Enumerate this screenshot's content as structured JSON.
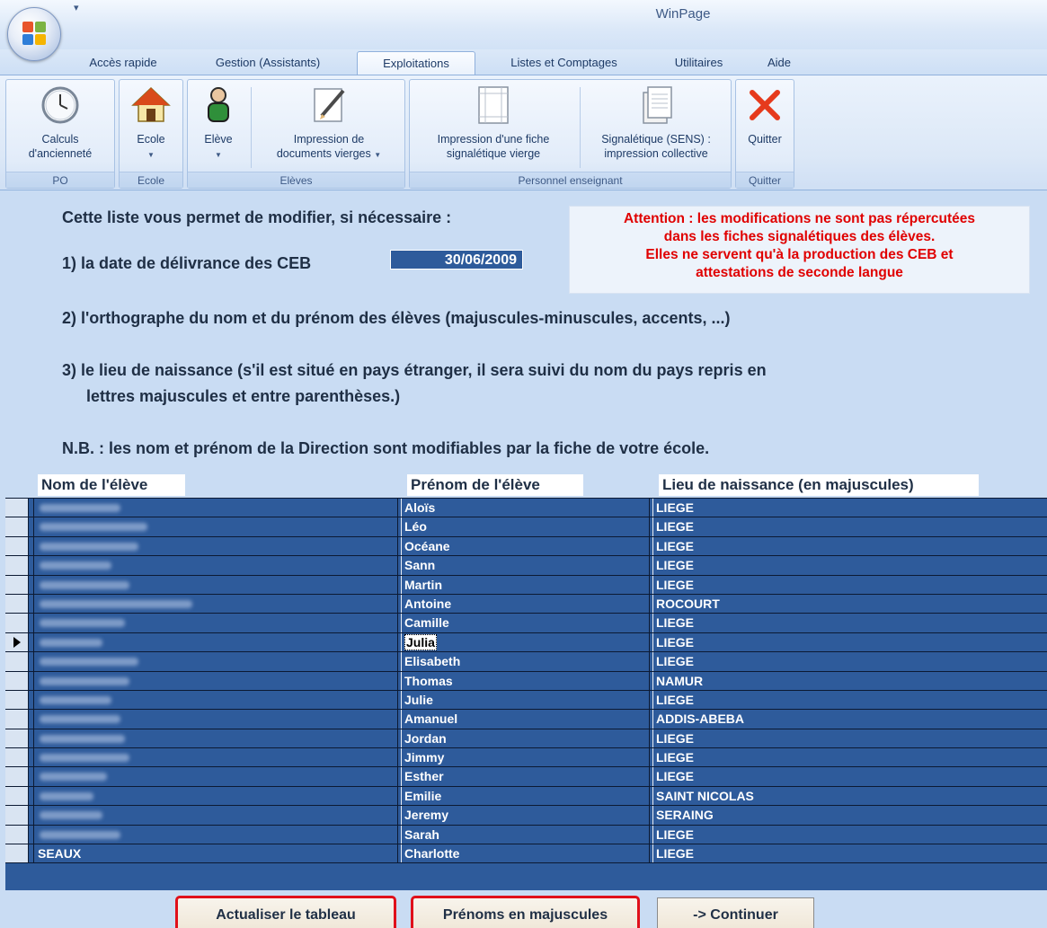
{
  "window": {
    "title": "WinPage"
  },
  "tabs": [
    {
      "label": "Accès rapide",
      "active": false
    },
    {
      "label": "Gestion (Assistants)",
      "active": false
    },
    {
      "label": "Exploitations",
      "active": true
    },
    {
      "label": "Listes et Comptages",
      "active": false
    },
    {
      "label": "Utilitaires",
      "active": false
    },
    {
      "label": "Aide",
      "active": false
    }
  ],
  "ribbon": {
    "groups": [
      {
        "label": "PO"
      },
      {
        "label": "Ecole"
      },
      {
        "label": "Elèves"
      },
      {
        "label": "Personnel enseignant"
      },
      {
        "label": "Quitter"
      }
    ],
    "buttons": {
      "calculs": {
        "label": "Calculs\nd'ancienneté",
        "icon": "clock-icon"
      },
      "ecole": {
        "label": "Ecole",
        "icon": "house-icon"
      },
      "eleve": {
        "label": "Elève",
        "icon": "person-icon"
      },
      "impression_docs": {
        "label": "Impression de\ndocuments vierges",
        "icon": "pencil-document-icon"
      },
      "impression_fiche": {
        "label": "Impression d'une fiche\nsignalétique vierge",
        "icon": "blank-form-icon"
      },
      "signaletique": {
        "label": "Signalétique (SENS) :\nimpression collective",
        "icon": "documents-icon"
      },
      "quitter": {
        "label": "Quitter",
        "icon": "red-x-icon"
      }
    }
  },
  "intro": {
    "line0": "Cette liste vous permet de modifier, si nécessaire :",
    "line1": "1) la date de délivrance des CEB",
    "date_value": "30/06/2009",
    "line2": "2) l'orthographe du nom et du prénom des élèves (majuscules-minuscules, accents, ...)",
    "line3a": "3) le lieu de naissance (s'il est situé en pays étranger, il sera suivi du nom du pays repris en",
    "line3b": "lettres majuscules et entre parenthèses.)",
    "nb": "N.B. : les nom et prénom de la Direction sont modifiables par la fiche de votre école."
  },
  "warning": {
    "line1": "Attention : les modifications ne sont pas répercutées",
    "line2": "dans les fiches signalétiques des élèves.",
    "line3": "Elles ne servent qu'à la production des CEB et",
    "line4": "attestations de seconde langue",
    "color": "#e00000"
  },
  "table": {
    "headers": {
      "nom": "Nom de l'élève",
      "prenom": "Prénom de l'élève",
      "lieu": "Lieu de naissance (en majuscules)"
    },
    "rows": [
      {
        "nom": "",
        "prenom": "Aloïs",
        "lieu": "LIEGE"
      },
      {
        "nom": "",
        "prenom": "Léo",
        "lieu": "LIEGE"
      },
      {
        "nom": "",
        "prenom": "Océane",
        "lieu": "LIEGE"
      },
      {
        "nom": "",
        "prenom": "Sann",
        "lieu": "LIEGE"
      },
      {
        "nom": "",
        "prenom": "Martin",
        "lieu": "LIEGE"
      },
      {
        "nom": "",
        "prenom": "Antoine",
        "lieu": "ROCOURT"
      },
      {
        "nom": "",
        "prenom": "Camille",
        "lieu": "LIEGE"
      },
      {
        "nom": "",
        "prenom": "Julia",
        "lieu": "LIEGE",
        "current": true
      },
      {
        "nom": "",
        "prenom": "Elisabeth",
        "lieu": "LIEGE"
      },
      {
        "nom": "",
        "prenom": "Thomas",
        "lieu": "NAMUR"
      },
      {
        "nom": "",
        "prenom": "Julie",
        "lieu": "LIEGE"
      },
      {
        "nom": "",
        "prenom": "Amanuel",
        "lieu": "ADDIS-ABEBA"
      },
      {
        "nom": "",
        "prenom": "Jordan",
        "lieu": "LIEGE"
      },
      {
        "nom": "",
        "prenom": "Jimmy",
        "lieu": "LIEGE"
      },
      {
        "nom": "",
        "prenom": "Esther",
        "lieu": "LIEGE"
      },
      {
        "nom": "",
        "prenom": "Emilie",
        "lieu": "SAINT NICOLAS"
      },
      {
        "nom": "",
        "prenom": "Jeremy",
        "lieu": "SERAING"
      },
      {
        "nom": "",
        "prenom": "Sarah",
        "lieu": "LIEGE"
      },
      {
        "nom": "SEAUX",
        "prenom": "Charlotte",
        "lieu": "LIEGE"
      }
    ]
  },
  "buttons": {
    "actualiser": "Actualiser le tableau",
    "majuscules": "Prénoms en majuscules",
    "continuer": "-> Continuer"
  },
  "colors": {
    "background": "#c9dcf3",
    "grid": "#2e5b9b",
    "highlight_outline": "#e0101a"
  }
}
